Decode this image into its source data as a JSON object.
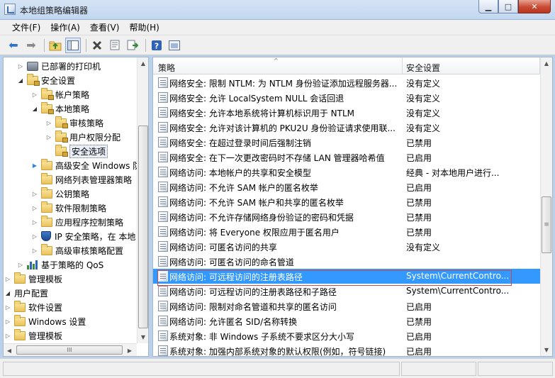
{
  "window": {
    "title": "本地组策略编辑器",
    "buttons": {
      "minimize": "▁",
      "maximize": "□",
      "close": "✕"
    }
  },
  "menu": [
    {
      "label": "文件(F)"
    },
    {
      "label": "操作(A)"
    },
    {
      "label": "查看(V)"
    },
    {
      "label": "帮助(H)"
    }
  ],
  "toolbar": {
    "icons": [
      "back-arrow-icon",
      "forward-arrow-icon",
      "up-folder-icon",
      "show-hide-tree-icon",
      "delete-icon",
      "properties-icon",
      "export-list-icon",
      "help-icon",
      "console-view-icon"
    ]
  },
  "tree": [
    {
      "label": "已部署的打印机",
      "icon": "printer-icon",
      "twisty": "collapsed",
      "level": 1
    },
    {
      "label": "安全设置",
      "icon": "folder-locked",
      "twisty": "expanded",
      "level": 1
    },
    {
      "label": "帐户策略",
      "icon": "folder-locked",
      "twisty": "collapsed",
      "level": 2
    },
    {
      "label": "本地策略",
      "icon": "folder-locked",
      "twisty": "expanded",
      "level": 2
    },
    {
      "label": "审核策略",
      "icon": "folder-locked",
      "twisty": "collapsed",
      "level": 3
    },
    {
      "label": "用户权限分配",
      "icon": "folder-locked",
      "twisty": "collapsed",
      "level": 3
    },
    {
      "label": "安全选项",
      "icon": "folder-locked",
      "twisty": "none",
      "level": 3,
      "selected": true
    },
    {
      "label": "高级安全 Windows 防",
      "icon": "folder-locked",
      "twisty": "collapsed-blue",
      "level": 2
    },
    {
      "label": "网络列表管理器策略",
      "icon": "folder",
      "twisty": "none",
      "level": 2
    },
    {
      "label": "公钥策略",
      "icon": "folder",
      "twisty": "collapsed",
      "level": 2
    },
    {
      "label": "软件限制策略",
      "icon": "folder",
      "twisty": "collapsed",
      "level": 2
    },
    {
      "label": "应用程序控制策略",
      "icon": "folder",
      "twisty": "collapsed",
      "level": 2
    },
    {
      "label": "IP 安全策略，在 本地",
      "icon": "shield-icon",
      "twisty": "collapsed",
      "level": 2
    },
    {
      "label": "高级审核策略配置",
      "icon": "folder",
      "twisty": "collapsed",
      "level": 2
    },
    {
      "label": "基于策略的 QoS",
      "icon": "chart-icon",
      "twisty": "collapsed",
      "level": 1
    },
    {
      "label": "管理模板",
      "icon": "folder",
      "twisty": "collapsed",
      "level": 0
    },
    {
      "label": "用户配置",
      "icon": "user-config-icon",
      "twisty": "expanded",
      "level": -1
    },
    {
      "label": "软件设置",
      "icon": "folder",
      "twisty": "collapsed",
      "level": 0
    },
    {
      "label": "Windows 设置",
      "icon": "folder",
      "twisty": "collapsed",
      "level": 0
    },
    {
      "label": "管理模板",
      "icon": "folder",
      "twisty": "collapsed",
      "level": 0
    }
  ],
  "list": {
    "columns": [
      "策略",
      "安全设置"
    ],
    "sort_caret": "^",
    "rows": [
      {
        "name": "网络安全: 限制 NTLM: 为 NTLM 身份验证添加远程服务器...",
        "value": "没有定义"
      },
      {
        "name": "网络安全: 允许 LocalSystem NULL 会话回退",
        "value": "没有定义"
      },
      {
        "name": "网络安全: 允许本地系统将计算机标识用于 NTLM",
        "value": "没有定义"
      },
      {
        "name": "网络安全: 允许对该计算机的 PKU2U 身份验证请求使用联...",
        "value": "没有定义"
      },
      {
        "name": "网络安全: 在超过登录时间后强制注销",
        "value": "已禁用"
      },
      {
        "name": "网络安全: 在下一次更改密码时不存储 LAN 管理器哈希值",
        "value": "已启用"
      },
      {
        "name": "网络访问: 本地帐户的共享和安全模型",
        "value": "经典 - 对本地用户进行..."
      },
      {
        "name": "网络访问: 不允许 SAM 帐户的匿名枚举",
        "value": "已启用"
      },
      {
        "name": "网络访问: 不允许 SAM 帐户和共享的匿名枚举",
        "value": "已禁用"
      },
      {
        "name": "网络访问: 不允许存储网络身份验证的密码和凭据",
        "value": "已禁用"
      },
      {
        "name": "网络访问: 将 Everyone 权限应用于匿名用户",
        "value": "已禁用"
      },
      {
        "name": "网络访问: 可匿名访问的共享",
        "value": "没有定义"
      },
      {
        "name": "网络访问: 可匿名访问的命名管道",
        "value": ""
      },
      {
        "name": "网络访问: 可远程访问的注册表路径",
        "value": "System\\CurrentContro...",
        "selected": true
      },
      {
        "name": "网络访问: 可远程访问的注册表路径和子路径",
        "value": "System\\CurrentContro..."
      },
      {
        "name": "网络访问: 限制对命名管道和共享的匿名访问",
        "value": "已启用"
      },
      {
        "name": "网络访问: 允许匿名 SID/名称转换",
        "value": "已禁用"
      },
      {
        "name": "系统对象: 非 Windows 子系统不要求区分大小写",
        "value": "已启用"
      },
      {
        "name": "系统对象: 加强内部系统对象的默认权限(例如，符号链接)",
        "value": "已启用"
      }
    ]
  },
  "scroll": {
    "left_thumb": "III",
    "right_grip": "≡"
  }
}
